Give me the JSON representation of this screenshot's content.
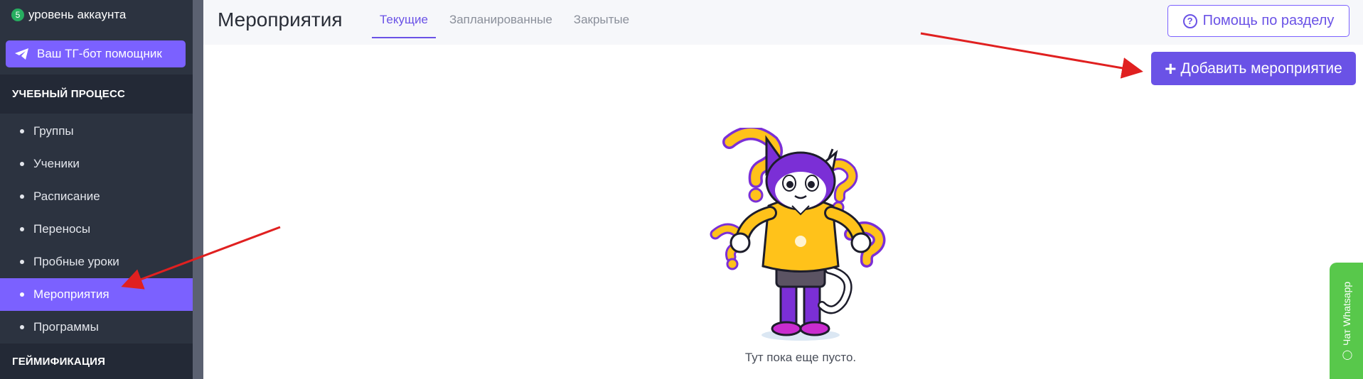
{
  "sidebar": {
    "level_number": "5",
    "level_label": "уровень аккаунта",
    "tg_button": "Ваш ТГ-бот помощник",
    "sections": [
      {
        "title": "УЧЕБНЫЙ ПРОЦЕСС"
      },
      {
        "title": "ГЕЙМИФИКАЦИЯ"
      }
    ],
    "items": [
      {
        "label": "Группы"
      },
      {
        "label": "Ученики"
      },
      {
        "label": "Расписание"
      },
      {
        "label": "Переносы"
      },
      {
        "label": "Пробные уроки"
      },
      {
        "label": "Мероприятия",
        "active": true
      },
      {
        "label": "Программы"
      }
    ]
  },
  "header": {
    "title": "Мероприятия",
    "tabs": [
      {
        "label": "Текущие",
        "active": true
      },
      {
        "label": "Запланированные"
      },
      {
        "label": "Закрытые"
      }
    ],
    "help_button": "Помощь по разделу"
  },
  "main": {
    "add_button": "Добавить мероприятие",
    "empty_text": "Тут пока еще пусто."
  },
  "whatsapp": {
    "label": "Чат Whatsapp"
  },
  "colors": {
    "accent": "#6a52e6",
    "sidebar_bg": "#2c3340",
    "active_item": "#7b61ff",
    "whatsapp": "#58c84b",
    "annotation_arrow": "#e02020"
  }
}
